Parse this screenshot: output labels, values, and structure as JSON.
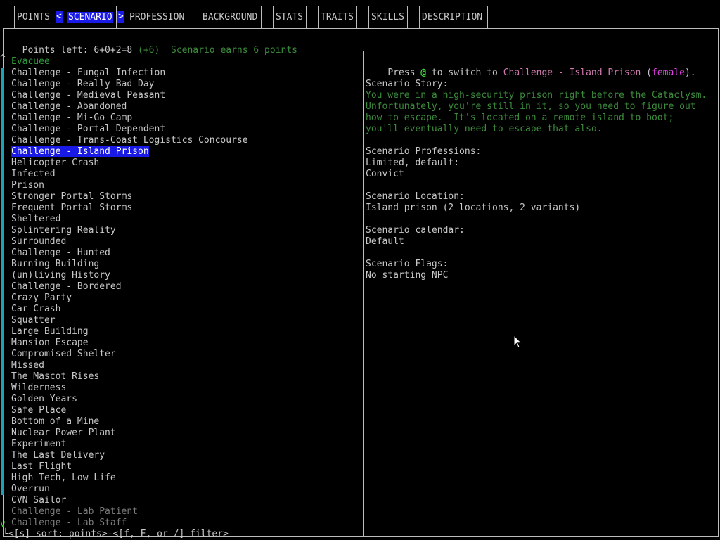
{
  "tabs": {
    "points": "POINTS",
    "scenario": "SCENARIO",
    "profession": "PROFESSION",
    "background": "BACKGROUND",
    "stats": "STATS",
    "traits": "TRAITS",
    "skills": "SKILLS",
    "description": "DESCRIPTION",
    "arrow_left": "<",
    "arrow_right": ">"
  },
  "points_bar": {
    "points_left": "Points left: 6+0+2=8",
    "delta": "(+6)",
    "earn_text": "Scenario earns 6 points"
  },
  "scenario_list": {
    "scroll_up": "^",
    "scroll_down": "v",
    "items": [
      {
        "label": "Evacuee",
        "style": "green"
      },
      {
        "label": "Challenge - Fungal Infection",
        "style": "normal"
      },
      {
        "label": "Challenge - Really Bad Day",
        "style": "normal"
      },
      {
        "label": "Challenge - Medieval Peasant",
        "style": "normal"
      },
      {
        "label": "Challenge - Abandoned",
        "style": "normal"
      },
      {
        "label": "Challenge - Mi-Go Camp",
        "style": "normal"
      },
      {
        "label": "Challenge - Portal Dependent",
        "style": "normal"
      },
      {
        "label": "Challenge - Trans-Coast Logistics Concourse",
        "style": "normal"
      },
      {
        "label": "Challenge - Island Prison",
        "style": "selected"
      },
      {
        "label": "Helicopter Crash",
        "style": "normal"
      },
      {
        "label": "Infected",
        "style": "normal"
      },
      {
        "label": "Prison",
        "style": "normal"
      },
      {
        "label": "Stronger Portal Storms",
        "style": "normal"
      },
      {
        "label": "Frequent Portal Storms",
        "style": "normal"
      },
      {
        "label": "Sheltered",
        "style": "normal"
      },
      {
        "label": "Splintering Reality",
        "style": "normal"
      },
      {
        "label": "Surrounded",
        "style": "normal"
      },
      {
        "label": "Challenge - Hunted",
        "style": "normal"
      },
      {
        "label": "Burning Building",
        "style": "normal"
      },
      {
        "label": "(un)living History",
        "style": "normal"
      },
      {
        "label": "Challenge - Bordered",
        "style": "normal"
      },
      {
        "label": "Crazy Party",
        "style": "normal"
      },
      {
        "label": "Car Crash",
        "style": "normal"
      },
      {
        "label": "Squatter",
        "style": "normal"
      },
      {
        "label": "Large Building",
        "style": "normal"
      },
      {
        "label": "Mansion Escape",
        "style": "normal"
      },
      {
        "label": "Compromised Shelter",
        "style": "normal"
      },
      {
        "label": "Missed",
        "style": "normal"
      },
      {
        "label": "The Mascot Rises",
        "style": "normal"
      },
      {
        "label": "Wilderness",
        "style": "normal"
      },
      {
        "label": "Golden Years",
        "style": "normal"
      },
      {
        "label": "Safe Place",
        "style": "normal"
      },
      {
        "label": "Bottom of a Mine",
        "style": "normal"
      },
      {
        "label": "Nuclear Power Plant",
        "style": "normal"
      },
      {
        "label": "Experiment",
        "style": "normal"
      },
      {
        "label": "The Last Delivery",
        "style": "normal"
      },
      {
        "label": "Last Flight",
        "style": "normal"
      },
      {
        "label": "High Tech, Low Life",
        "style": "normal"
      },
      {
        "label": "Overrun",
        "style": "normal"
      },
      {
        "label": "CVN Sailor",
        "style": "normal"
      },
      {
        "label": "Challenge - Lab Patient",
        "style": "gray"
      },
      {
        "label": "Challenge - Lab Staff",
        "style": "gray"
      }
    ]
  },
  "footer": {
    "text": "<[s] sort: points>-<[f, F, or /] filter>"
  },
  "details": {
    "press_prefix": "Press ",
    "press_key": "@",
    "press_middle": " to switch to ",
    "press_target": "Challenge - Island Prison",
    "press_paren_open": " (",
    "press_gender": "female",
    "press_paren_close": ").",
    "story_heading": "Scenario Story:",
    "story_lines": [
      "You were in a high-security prison right before the Cataclysm.",
      "Unfortunately, you're still in it, so you need to figure out",
      "how to escape.  It's located on a remote island to boot;",
      "you'll eventually need to escape that also."
    ],
    "professions_heading": "Scenario Professions:",
    "professions_lines": [
      "Limited, default:",
      "Convict"
    ],
    "location_heading": "Scenario Location:",
    "location_value": "Island prison (2 locations, 2 variants)",
    "calendar_heading": "Scenario calendar:",
    "calendar_value": "Default",
    "flags_heading": "Scenario Flags:",
    "flags_value": "No starting NPC"
  },
  "colors": {
    "selection": "#1a1ae6",
    "green_text": "#2e9a3a",
    "border": "#bdbdbd",
    "scrollbar": "#1fa0b4"
  }
}
